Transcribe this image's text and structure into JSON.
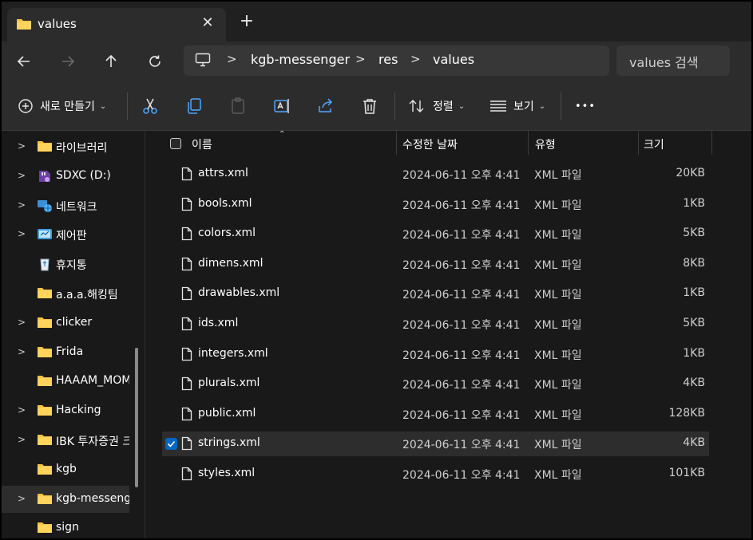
{
  "tab": {
    "title": "values",
    "close": "✕",
    "new_tab": "+"
  },
  "nav": {
    "breadcrumb": [
      "kgb-messenger",
      "res",
      "values"
    ],
    "search_placeholder": "values 검색"
  },
  "toolbar": {
    "new_label": "새로 만들기",
    "sort_label": "정렬",
    "view_label": "보기",
    "more": "•••"
  },
  "sidebar": {
    "items": [
      {
        "label": "라이브러리",
        "icon": "library-folder-icon",
        "expandable": true
      },
      {
        "label": "SDXC (D:)",
        "icon": "sd-card-icon",
        "expandable": true
      },
      {
        "label": "네트워크",
        "icon": "network-icon",
        "expandable": true
      },
      {
        "label": "제어판",
        "icon": "control-panel-icon",
        "expandable": true
      },
      {
        "label": "휴지통",
        "icon": "recycle-bin-icon",
        "expandable": false
      },
      {
        "label": "a.a.a.해킹팀",
        "icon": "folder-icon",
        "expandable": false
      },
      {
        "label": "clicker",
        "icon": "folder-icon",
        "expandable": true
      },
      {
        "label": "Frida",
        "icon": "folder-icon",
        "expandable": true
      },
      {
        "label": "HAAAM_MOM",
        "icon": "folder-icon",
        "expandable": false
      },
      {
        "label": "Hacking",
        "icon": "folder-icon",
        "expandable": true
      },
      {
        "label": "IBK 투자증권 크",
        "icon": "folder-icon",
        "expandable": true
      },
      {
        "label": "kgb",
        "icon": "folder-icon",
        "expandable": false
      },
      {
        "label": "kgb-messenger",
        "icon": "folder-icon",
        "expandable": true
      },
      {
        "label": "sign",
        "icon": "folder-icon",
        "expandable": false
      }
    ],
    "selected_index": 12
  },
  "columns": {
    "name": "이름",
    "date": "수정한 날짜",
    "type": "유형",
    "size": "크기"
  },
  "files": [
    {
      "name": "attrs.xml",
      "date": "2024-06-11 오후 4:41",
      "type": "XML 파일",
      "size": "20KB"
    },
    {
      "name": "bools.xml",
      "date": "2024-06-11 오후 4:41",
      "type": "XML 파일",
      "size": "1KB"
    },
    {
      "name": "colors.xml",
      "date": "2024-06-11 오후 4:41",
      "type": "XML 파일",
      "size": "5KB"
    },
    {
      "name": "dimens.xml",
      "date": "2024-06-11 오후 4:41",
      "type": "XML 파일",
      "size": "8KB"
    },
    {
      "name": "drawables.xml",
      "date": "2024-06-11 오후 4:41",
      "type": "XML 파일",
      "size": "1KB"
    },
    {
      "name": "ids.xml",
      "date": "2024-06-11 오후 4:41",
      "type": "XML 파일",
      "size": "5KB"
    },
    {
      "name": "integers.xml",
      "date": "2024-06-11 오후 4:41",
      "type": "XML 파일",
      "size": "1KB"
    },
    {
      "name": "plurals.xml",
      "date": "2024-06-11 오후 4:41",
      "type": "XML 파일",
      "size": "4KB"
    },
    {
      "name": "public.xml",
      "date": "2024-06-11 오후 4:41",
      "type": "XML 파일",
      "size": "128KB"
    },
    {
      "name": "strings.xml",
      "date": "2024-06-11 오후 4:41",
      "type": "XML 파일",
      "size": "4KB"
    },
    {
      "name": "styles.xml",
      "date": "2024-06-11 오후 4:41",
      "type": "XML 파일",
      "size": "101KB"
    }
  ],
  "selected_file_index": 9,
  "colors": {
    "accent": "#0067c0",
    "folder": "#f5c342",
    "background": "#191919",
    "chrome": "#2c2c2c"
  }
}
